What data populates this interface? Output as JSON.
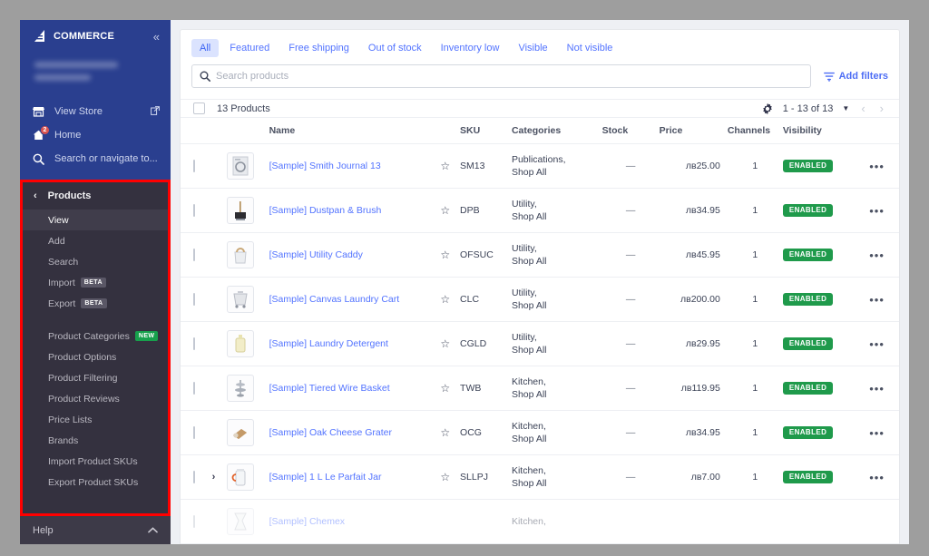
{
  "sidebar": {
    "brand": "COMMERCE",
    "brand_mark": "big-logo-icon",
    "collapse_icon": "«",
    "links": [
      {
        "label": "View Store",
        "icon": "store-icon",
        "trailing_icon": "external-link-icon"
      },
      {
        "label": "Home",
        "icon": "home-icon",
        "badge": "2"
      },
      {
        "label": "Search or navigate to...",
        "icon": "search-icon"
      }
    ],
    "panel": {
      "title": "Products",
      "back_icon": "chevron-left-icon",
      "items": [
        {
          "label": "View",
          "active": true
        },
        {
          "label": "Add"
        },
        {
          "label": "Search"
        },
        {
          "label": "Import",
          "tag": "BETA",
          "tag_type": "beta"
        },
        {
          "label": "Export",
          "tag": "BETA",
          "tag_type": "beta"
        },
        {
          "gap": true
        },
        {
          "label": "Product Categories",
          "tag": "NEW",
          "tag_type": "new"
        },
        {
          "label": "Product Options"
        },
        {
          "label": "Product Filtering"
        },
        {
          "label": "Product Reviews"
        },
        {
          "label": "Price Lists"
        },
        {
          "label": "Brands"
        },
        {
          "label": "Import Product SKUs"
        },
        {
          "label": "Export Product SKUs"
        }
      ]
    },
    "help": {
      "label": "Help",
      "icon": "chevron-up-icon"
    },
    "highlight_color": "#ff0000"
  },
  "filters": {
    "tabs": [
      {
        "label": "All",
        "active": true
      },
      {
        "label": "Featured",
        "active": false
      },
      {
        "label": "Free shipping",
        "active": false
      },
      {
        "label": "Out of stock",
        "active": false
      },
      {
        "label": "Inventory low",
        "active": false
      },
      {
        "label": "Visible",
        "active": false
      },
      {
        "label": "Not visible",
        "active": false
      }
    ],
    "search": {
      "placeholder": "Search products",
      "value": "",
      "icon": "search-icon"
    },
    "add_filters": {
      "label": "Add filters",
      "icon": "filter-icon"
    }
  },
  "toolbar": {
    "count_label": "13 Products",
    "settings_icon": "gear-icon",
    "page_range": "1 - 13 of 13",
    "dropdown_icon": "caret-down-icon",
    "prev_icon": "‹",
    "next_icon": "›"
  },
  "table": {
    "columns": [
      "Name",
      "SKU",
      "Categories",
      "Stock",
      "Price",
      "Channels",
      "Visibility"
    ],
    "rows": [
      {
        "name": "[Sample] Smith Journal 13",
        "sku": "SM13",
        "categories": "Publications, Shop All",
        "stock": "—",
        "price": "лв25.00",
        "channels": "1",
        "visibility": "ENABLED",
        "thumb": "journal-thumb",
        "expandable": false
      },
      {
        "name": "[Sample] Dustpan & Brush",
        "sku": "DPB",
        "categories": "Utility, Shop All",
        "stock": "—",
        "price": "лв34.95",
        "channels": "1",
        "visibility": "ENABLED",
        "thumb": "dustpan-thumb",
        "expandable": false
      },
      {
        "name": "[Sample] Utility Caddy",
        "sku": "OFSUC",
        "categories": "Utility, Shop All",
        "stock": "—",
        "price": "лв45.95",
        "channels": "1",
        "visibility": "ENABLED",
        "thumb": "caddy-thumb",
        "expandable": false
      },
      {
        "name": "[Sample] Canvas Laundry Cart",
        "sku": "CLC",
        "categories": "Utility, Shop All",
        "stock": "—",
        "price": "лв200.00",
        "channels": "1",
        "visibility": "ENABLED",
        "thumb": "cart-thumb",
        "expandable": false
      },
      {
        "name": "[Sample] Laundry Detergent",
        "sku": "CGLD",
        "categories": "Utility, Shop All",
        "stock": "—",
        "price": "лв29.95",
        "channels": "1",
        "visibility": "ENABLED",
        "thumb": "detergent-thumb",
        "expandable": false
      },
      {
        "name": "[Sample] Tiered Wire Basket",
        "sku": "TWB",
        "categories": "Kitchen, Shop All",
        "stock": "—",
        "price": "лв119.95",
        "channels": "1",
        "visibility": "ENABLED",
        "thumb": "basket-thumb",
        "expandable": false
      },
      {
        "name": "[Sample] Oak Cheese Grater",
        "sku": "OCG",
        "categories": "Kitchen, Shop All",
        "stock": "—",
        "price": "лв34.95",
        "channels": "1",
        "visibility": "ENABLED",
        "thumb": "grater-thumb",
        "expandable": false
      },
      {
        "name": "[Sample] 1 L Le Parfait Jar",
        "sku": "SLLPJ",
        "categories": "Kitchen, Shop All",
        "stock": "—",
        "price": "лв7.00",
        "channels": "1",
        "visibility": "ENABLED",
        "thumb": "jar-thumb",
        "expandable": true
      },
      {
        "name": "[Sample] Chemex",
        "sku": "",
        "categories": "Kitchen,",
        "stock": "",
        "price": "",
        "channels": "",
        "visibility": "",
        "thumb": "chemex-thumb",
        "expandable": false,
        "clipped": true
      }
    ],
    "star_icon": "star-outline-icon",
    "more_icon": "ellipsis-icon",
    "expand_icon": "chevron-right-icon"
  }
}
